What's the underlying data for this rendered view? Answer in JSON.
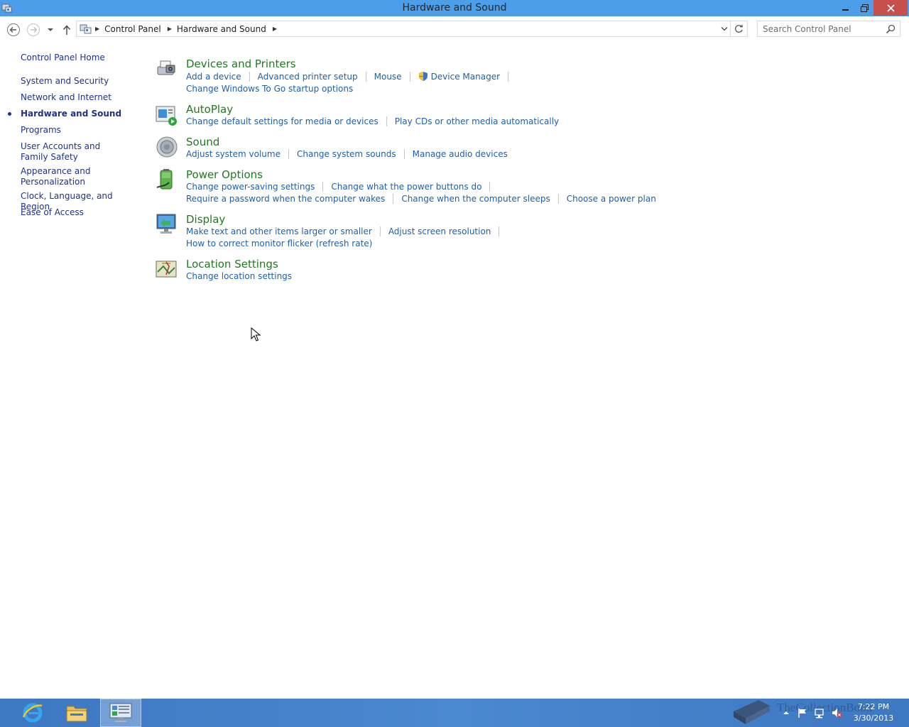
{
  "window": {
    "title": "Hardware and Sound"
  },
  "address": {
    "crumbs": [
      "Control Panel",
      "Hardware and Sound"
    ],
    "search_placeholder": "Search Control Panel"
  },
  "left_pane": {
    "items": [
      {
        "label": "Control Panel Home"
      },
      {
        "label": "System and Security"
      },
      {
        "label": "Network and Internet"
      },
      {
        "label": "Hardware and Sound",
        "active": true
      },
      {
        "label": "Programs"
      },
      {
        "label": "User Accounts and Family Safety"
      },
      {
        "label": "Appearance and Personalization"
      },
      {
        "label": "Clock, Language, and Region"
      },
      {
        "label": "Ease of Access"
      }
    ]
  },
  "categories": {
    "devices": {
      "title": "Devices and Printers",
      "links": [
        "Add a device",
        "Advanced printer setup",
        "Mouse",
        "Device Manager",
        "Change Windows To Go startup options"
      ]
    },
    "autoplay": {
      "title": "AutoPlay",
      "links": [
        "Change default settings for media or devices",
        "Play CDs or other media automatically"
      ]
    },
    "sound": {
      "title": "Sound",
      "links": [
        "Adjust system volume",
        "Change system sounds",
        "Manage audio devices"
      ]
    },
    "power": {
      "title": "Power Options",
      "links": [
        "Change power-saving settings",
        "Change what the power buttons do",
        "Require a password when the computer wakes",
        "Change when the computer sleeps",
        "Choose a power plan"
      ]
    },
    "display": {
      "title": "Display",
      "links": [
        "Make text and other items larger or smaller",
        "Adjust screen resolution",
        "How to correct monitor flicker (refresh rate)"
      ]
    },
    "location": {
      "title": "Location Settings",
      "links": [
        "Change location settings"
      ]
    }
  },
  "taskbar": {
    "clock_time": "7:22 PM",
    "clock_date": "3/30/2013",
    "watermark": "TheCollectionBook"
  },
  "colors": {
    "titlebar": "#4c9ee8",
    "close": "#c7504d",
    "link": "#1e5fad",
    "category_title": "#1e7a1e",
    "nav_text": "#1e3287",
    "taskbar": "#4a88d0"
  }
}
